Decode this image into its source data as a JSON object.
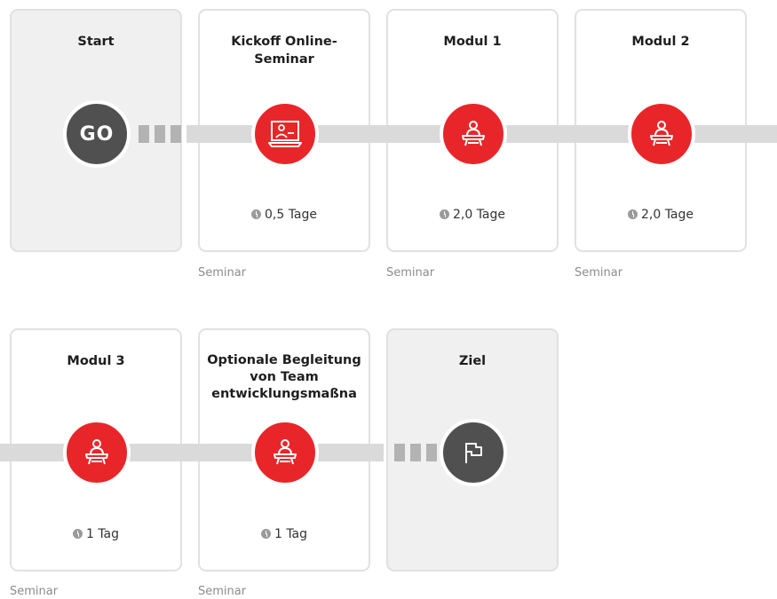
{
  "cards": [
    {
      "title": "Start",
      "duration": "",
      "category": ""
    },
    {
      "title": "Kickoff Online-Seminar",
      "duration": "0,5 Tage",
      "category": "Seminar"
    },
    {
      "title": "Modul 1",
      "duration": "2,0 Tage",
      "category": "Seminar"
    },
    {
      "title": "Modul 2",
      "duration": "2,0 Tage",
      "category": "Seminar"
    },
    {
      "title": "Modul 3",
      "duration": "1 Tag",
      "category": "Seminar"
    },
    {
      "title": "Optionale Begleitung von Team entwicklungsmaßna",
      "duration": "1 Tag",
      "category": "Seminar"
    },
    {
      "title": "Ziel",
      "duration": "",
      "category": ""
    }
  ],
  "start_label": "GO",
  "icons": [
    "go",
    "laptop-person-icon",
    "person-desk-icon",
    "person-desk-icon",
    "person-desk-icon",
    "person-desk-icon",
    "flag-icon"
  ],
  "colors": {
    "accent": "#e8262a",
    "dark": "#505050",
    "track": "#dadada",
    "card_border": "#e1e1e1",
    "card_grey": "#f0f0f0"
  }
}
